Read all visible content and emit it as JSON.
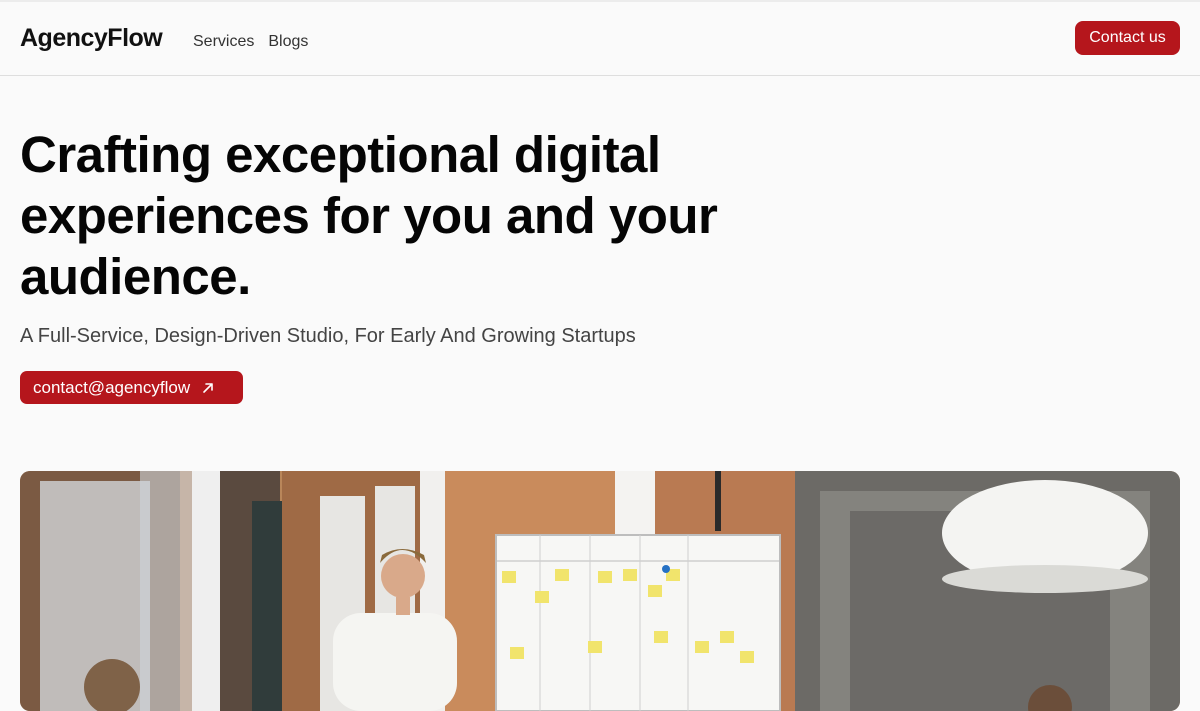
{
  "nav": {
    "brand": "AgencyFlow",
    "links": [
      "Services",
      "Blogs"
    ],
    "cta_label": "Contact us"
  },
  "hero": {
    "title": "Crafting exceptional digital experiences for you and your audience.",
    "subtitle": "A Full-Service, Design-Driven Studio, For Early And Growing Startups",
    "email_button_label": "contact@agencyflow",
    "email_button_icon": "arrow-up-right-icon"
  },
  "colors": {
    "accent": "#b5161c",
    "background": "#fafafa",
    "text": "#0b0b0b"
  }
}
